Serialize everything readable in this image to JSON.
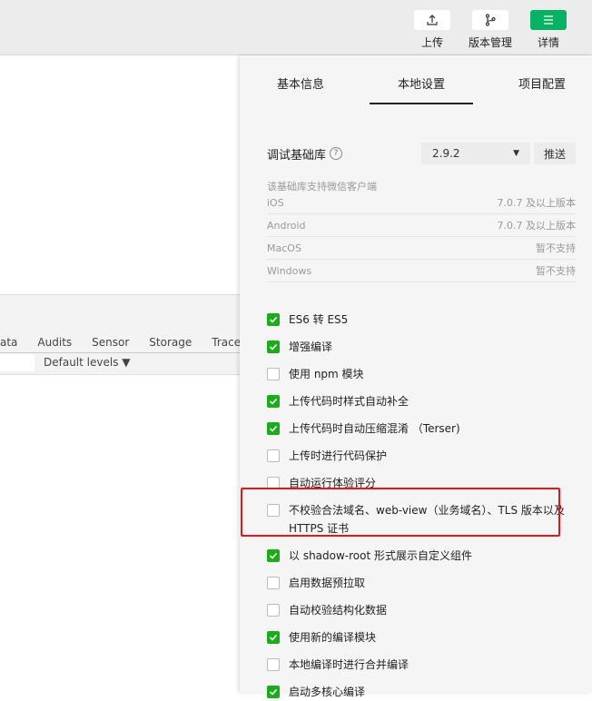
{
  "toolbar": {
    "buttons": [
      {
        "label": "上传",
        "icon": "upload-icon"
      },
      {
        "label": "版本管理",
        "icon": "branch-icon"
      },
      {
        "label": "详情",
        "icon": "menu-icon",
        "accent": "#07b264"
      }
    ]
  },
  "devtools": {
    "tabs": [
      "ata",
      "Audits",
      "Sensor",
      "Storage",
      "Trace"
    ],
    "levels": "Default levels ▼"
  },
  "panel": {
    "tabs": [
      "基本信息",
      "本地设置",
      "项目配置"
    ],
    "active_tab": "本地设置",
    "lib_label": "调试基础库",
    "lib_version": "2.9.2",
    "push_label": "推送",
    "support_title": "该基础库支持微信客户端",
    "clients": [
      {
        "name": "iOS",
        "value": "7.0.7 及以上版本"
      },
      {
        "name": "Android",
        "value": "7.0.7 及以上版本"
      },
      {
        "name": "MacOS",
        "value": "暂不支持"
      },
      {
        "name": "Windows",
        "value": "暂不支持"
      }
    ],
    "options": [
      {
        "label": "ES6 转 ES5",
        "checked": true
      },
      {
        "label": "增强编译",
        "checked": true
      },
      {
        "label": "使用 npm 模块",
        "checked": false
      },
      {
        "label": "上传代码时样式自动补全",
        "checked": true
      },
      {
        "label": "上传代码时自动压缩混淆 （Terser)",
        "checked": true
      },
      {
        "label": "上传时进行代码保护",
        "checked": false
      },
      {
        "label": "自动运行体验评分",
        "checked": false
      },
      {
        "label": "不校验合法域名、web-view（业务域名）、TLS 版本以及 HTTPS 证书",
        "checked": false,
        "highlighted": true
      },
      {
        "label": "以 shadow-root 形式展示自定义组件",
        "checked": true
      },
      {
        "label": "启用数据预拉取",
        "checked": false
      },
      {
        "label": "自动校验结构化数据",
        "checked": false
      },
      {
        "label": "使用新的编译模块",
        "checked": true
      },
      {
        "label": "本地编译时进行合并编译",
        "checked": false
      },
      {
        "label": "启动多核心编译",
        "checked": true
      }
    ]
  }
}
